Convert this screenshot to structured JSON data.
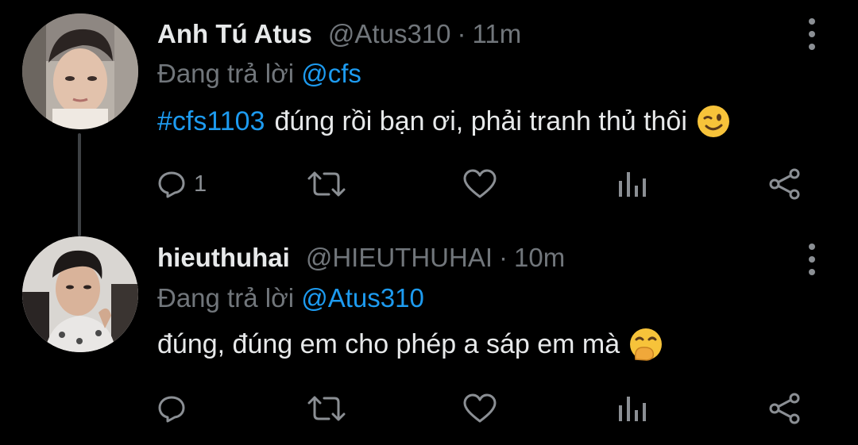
{
  "tweets": [
    {
      "display_name": "Anh Tú Atus",
      "handle": "@Atus310",
      "separator": "·",
      "time": "11m",
      "reply_prefix": "Đang trả lời",
      "reply_mention": "@cfs",
      "hashtag": "#cfs1103",
      "text": "đúng rồi bạn ơi, phải tranh thủ thôi",
      "emoji": "winking-face",
      "reply_count": "1"
    },
    {
      "display_name": "hieuthuhai",
      "handle": "@HIEUTHUHAI",
      "separator": "·",
      "time": "10m",
      "reply_prefix": "Đang trả lời",
      "reply_mention": "@Atus310",
      "text": "đúng, đúng em cho phép a sáp em mà",
      "emoji": "face-with-hand-over-mouth",
      "reply_count": ""
    }
  ],
  "colors": {
    "background": "#000000",
    "primary_text": "#e7e9ea",
    "secondary_text": "#71767b",
    "link": "#1d9bf0",
    "icon": "#8b8f94"
  }
}
